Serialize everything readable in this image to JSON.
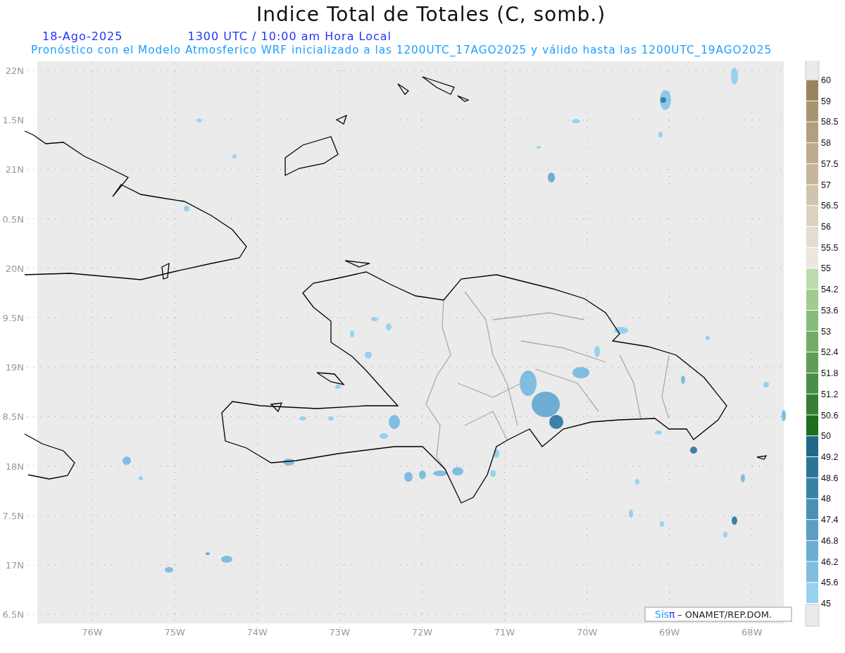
{
  "title": "Indice Total de Totales (C, somb.)",
  "date": "18-Ago-2025",
  "time": "1300 UTC / 10:00 am Hora Local",
  "subtitle": "Pronóstico con el Modelo Atmosferico WRF inicializado a las 1200UTC_17AGO2025 y válido hasta las  1200UTC_19AGO2025",
  "lat_labels": [
    "22N",
    "1.5N",
    "21N",
    "0.5N",
    "20N",
    "9.5N",
    "19N",
    "8.5N",
    "18N",
    "7.5N",
    "17N",
    "6.5N"
  ],
  "lon_labels": [
    "76W",
    "75W",
    "74W",
    "73W",
    "72W",
    "71W",
    "70W",
    "69W",
    "68W"
  ],
  "credit": {
    "logo_a": "Sis",
    "logo_b": "π",
    "text": "– ONAMET/REP.DOM."
  },
  "legend": {
    "labels": [
      "60",
      "59",
      "58.5",
      "58",
      "57.5",
      "57",
      "56.5",
      "56",
      "55.5",
      "55",
      "54.2",
      "53.6",
      "53",
      "52.4",
      "51.8",
      "51.2",
      "50.6",
      "50",
      "49.2",
      "48.6",
      "48",
      "47.4",
      "46.8",
      "46.2",
      "45.6",
      "45"
    ],
    "segments": [
      {
        "color": "#9a8460"
      },
      {
        "color": "#a99470"
      },
      {
        "color": "#b29f7e"
      },
      {
        "color": "#bcab8d"
      },
      {
        "color": "#c6b69c"
      },
      {
        "color": "#d1c4ad"
      },
      {
        "color": "#dbd2c1"
      },
      {
        "color": "#e3dcd1"
      },
      {
        "color": "#ebe7de"
      },
      {
        "color": "#bddcae"
      },
      {
        "color": "#a1cb90"
      },
      {
        "color": "#86bb78"
      },
      {
        "color": "#74ac67"
      },
      {
        "color": "#609e57"
      },
      {
        "color": "#4a8f46"
      },
      {
        "color": "#347f34"
      },
      {
        "color": "#1d6e1d"
      },
      {
        "color": "#216888"
      },
      {
        "color": "#2d7597"
      },
      {
        "color": "#3a82a5"
      },
      {
        "color": "#4a90b4"
      },
      {
        "color": "#5b9ec2"
      },
      {
        "color": "#6dadd1"
      },
      {
        "color": "#80bde0"
      },
      {
        "color": "#98d1f0"
      }
    ]
  }
}
